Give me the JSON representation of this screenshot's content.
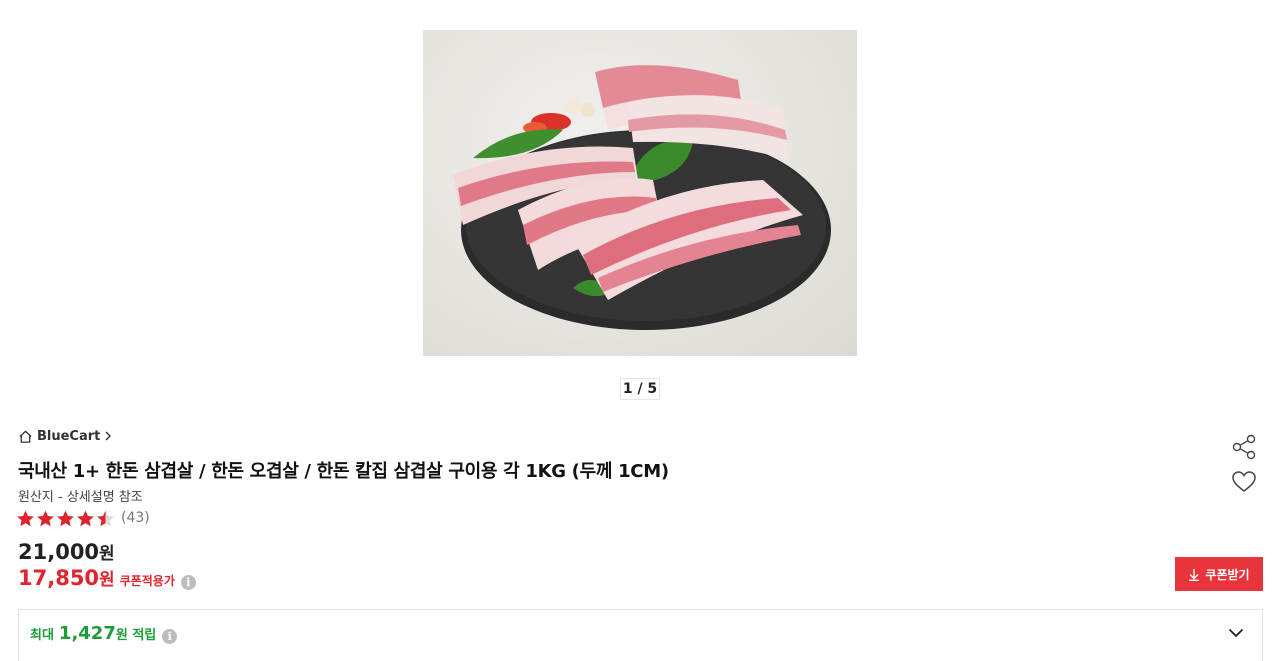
{
  "gallery": {
    "counter": "1 / 5"
  },
  "seller": {
    "name": "BlueCart"
  },
  "product": {
    "title": "국내산 1+ 한돈 삼겹살 / 한돈 오겹살 / 한돈 칼집 삼겹살 구이용 각 1KG (두께 1CM)",
    "origin": "원산지 - 상세설명 참조",
    "rating": 4.5,
    "review_count": "(43)"
  },
  "price": {
    "original": "21,000",
    "original_unit": "원",
    "sale": "17,850",
    "sale_unit": "원",
    "coupon_label": "쿠폰적용가"
  },
  "coupon_button": {
    "label": "쿠폰받기"
  },
  "points": {
    "prefix": "최대",
    "amount": "1,427",
    "suffix": "원 적립"
  },
  "colors": {
    "accent_red": "#e8343b",
    "sale_red": "#e0242d",
    "points_green": "#1e9c38",
    "star_red": "#e0242d"
  },
  "icons": [
    "home-icon",
    "chevron-right-icon",
    "share-icon",
    "heart-icon",
    "download-icon",
    "info-icon",
    "chevron-down-icon",
    "star-icon"
  ]
}
